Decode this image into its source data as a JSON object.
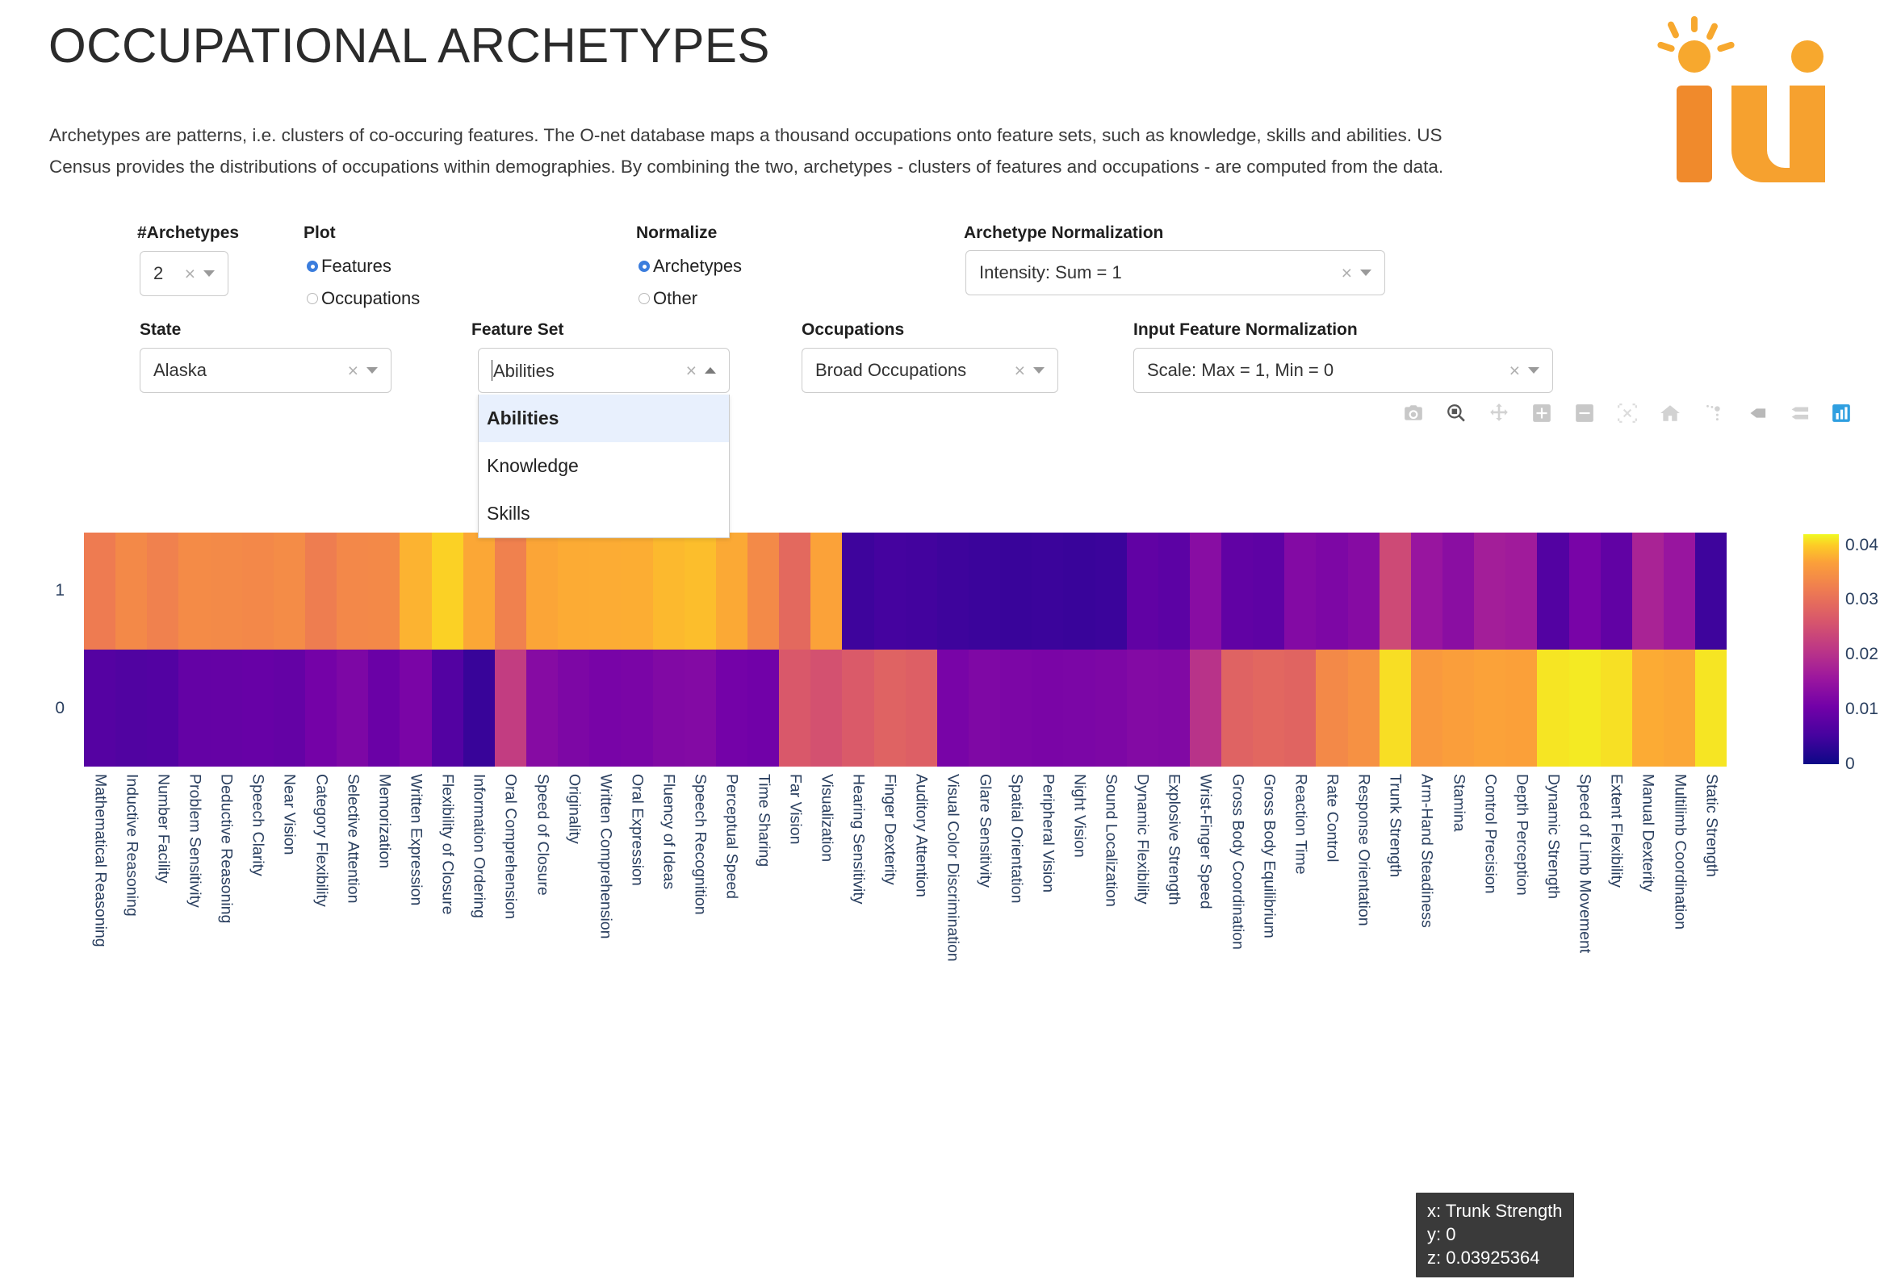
{
  "header": {
    "title": "OCCUPATIONAL ARCHETYPES",
    "intro": "Archetypes are patterns, i.e. clusters of co-occuring features. The O-net database maps a thousand occupations onto feature sets, such as knowledge, skills and abilities. US Census provides the distributions of occupations within demographies. By combining the two, archetypes - clusters of features and occupations - are computed from the data.",
    "logo_alt": "i4i-logo"
  },
  "controls": {
    "archetypes": {
      "label": "#Archetypes",
      "value": "2"
    },
    "plot": {
      "label": "Plot",
      "options": [
        {
          "label": "Features",
          "selected": true
        },
        {
          "label": "Occupations",
          "selected": false
        }
      ]
    },
    "normalize": {
      "label": "Normalize",
      "options": [
        {
          "label": "Archetypes",
          "selected": true
        },
        {
          "label": "Other",
          "selected": false
        }
      ]
    },
    "archetype_normalization": {
      "label": "Archetype Normalization",
      "value": "Intensity: Sum = 1"
    },
    "state": {
      "label": "State",
      "value": "Alaska"
    },
    "feature_set": {
      "label": "Feature Set",
      "value": "Abilities",
      "open": true,
      "options": [
        "Abilities",
        "Knowledge",
        "Skills"
      ],
      "selected_index": 0
    },
    "occupations": {
      "label": "Occupations",
      "value": "Broad Occupations"
    },
    "input_feature_normalization": {
      "label": "Input Feature Normalization",
      "value": "Scale: Max = 1, Min = 0"
    }
  },
  "modebar": {
    "buttons": [
      "camera-icon",
      "zoom-icon",
      "pan-icon",
      "zoom-in-icon",
      "zoom-out-icon",
      "autoscale-icon",
      "reset-axes-icon",
      "spike-lines-icon",
      "hover-closest-icon",
      "hover-compare-icon",
      "plotly-logo-icon"
    ]
  },
  "tooltip": {
    "x_label": "x: Trunk Strength",
    "y_label": "y: 0",
    "z_label": "z: 0.03925364"
  },
  "chart_data": {
    "type": "heatmap",
    "title": "",
    "xlabel": "",
    "ylabel": "",
    "colorscale": "Plasma",
    "colorbar": {
      "ticks": [
        "0.04",
        "0.03",
        "0.02",
        "0.01",
        "0"
      ],
      "zmin": 0,
      "zmax": 0.042,
      "position": "right"
    },
    "y": [
      "1",
      "0"
    ],
    "categories": [
      "Mathematical Reasoning",
      "Inductive Reasoning",
      "Number Facility",
      "Problem Sensitivity",
      "Deductive Reasoning",
      "Speech Clarity",
      "Near Vision",
      "Category Flexibility",
      "Selective Attention",
      "Memorization",
      "Written Expression",
      "Flexibility of Closure",
      "Information Ordering",
      "Oral Comprehension",
      "Speed of Closure",
      "Originality",
      "Written Comprehension",
      "Oral Expression",
      "Fluency of Ideas",
      "Speech Recognition",
      "Perceptual Speed",
      "Time Sharing",
      "Far Vision",
      "Visualization",
      "Hearing Sensitivity",
      "Finger Dexterity",
      "Auditory Attention",
      "Visual Color Discrimination",
      "Glare Sensitivity",
      "Spatial Orientation",
      "Peripheral Vision",
      "Night Vision",
      "Sound Localization",
      "Dynamic Flexibility",
      "Explosive Strength",
      "Wrist-Finger Speed",
      "Gross Body Coordination",
      "Gross Body Equilibrium",
      "Reaction Time",
      "Rate Control",
      "Response Orientation",
      "Trunk Strength",
      "Arm-Hand Steadiness",
      "Stamina",
      "Control Precision",
      "Depth Perception",
      "Dynamic Strength",
      "Speed of Limb Movement",
      "Extent Flexibility",
      "Manual Dexterity",
      "Multilimb Coordination",
      "Static Strength"
    ],
    "series": [
      {
        "name": "1",
        "values": [
          0.0283,
          0.03,
          0.029,
          0.0302,
          0.0301,
          0.0299,
          0.0303,
          0.0285,
          0.0299,
          0.03,
          0.0348,
          0.038,
          0.0335,
          0.029,
          0.0333,
          0.034,
          0.0341,
          0.0342,
          0.0355,
          0.036,
          0.0338,
          0.0301,
          0.0258,
          0.033,
          0.004,
          0.0046,
          0.0044,
          0.004,
          0.0038,
          0.0036,
          0.0038,
          0.0036,
          0.0038,
          0.0075,
          0.007,
          0.0118,
          0.0075,
          0.0072,
          0.0112,
          0.0105,
          0.0115,
          0.0215,
          0.0135,
          0.012,
          0.015,
          0.0145,
          0.006,
          0.01,
          0.0075,
          0.0158,
          0.0135,
          0.004
        ]
      },
      {
        "name": "0",
        "values": [
          0.0063,
          0.0058,
          0.006,
          0.0078,
          0.0079,
          0.0082,
          0.0078,
          0.0096,
          0.0105,
          0.0085,
          0.0102,
          0.006,
          0.0035,
          0.0195,
          0.0115,
          0.0105,
          0.01,
          0.0102,
          0.011,
          0.0112,
          0.0095,
          0.0092,
          0.0235,
          0.0225,
          0.0238,
          0.025,
          0.0245,
          0.01,
          0.0108,
          0.0104,
          0.0102,
          0.0103,
          0.0105,
          0.0112,
          0.011,
          0.018,
          0.025,
          0.0255,
          0.0252,
          0.03,
          0.031,
          0.0393,
          0.032,
          0.0325,
          0.033,
          0.0328,
          0.04,
          0.0405,
          0.0395,
          0.034,
          0.0335,
          0.04
        ]
      }
    ]
  }
}
